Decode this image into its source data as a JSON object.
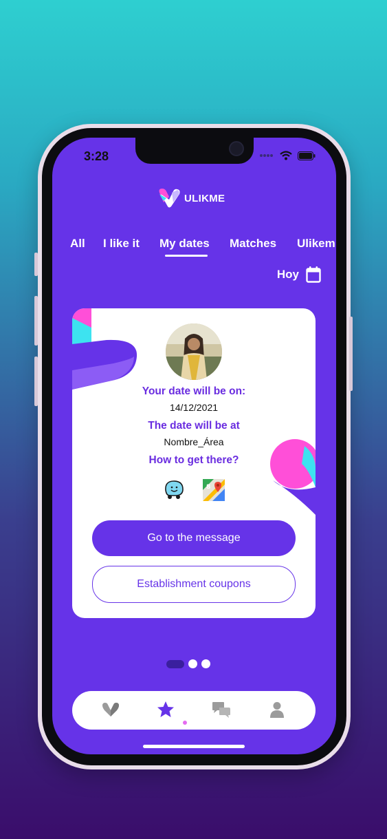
{
  "status_bar": {
    "time": "3:28"
  },
  "app": {
    "name": "ULIKME"
  },
  "tabs": [
    "All",
    "I like it",
    "My dates",
    "Matches",
    "Ulikem"
  ],
  "active_tab": "My dates",
  "date_filter": {
    "label": "Hoy"
  },
  "date_card": {
    "date_label": "Your date will be on:",
    "date_value": "14/12/2021",
    "place_label": "The date will be at",
    "place_value": "Nombre_Área",
    "directions_label": "How to get there?",
    "nav_apps": [
      "waze-icon",
      "google-maps-icon"
    ],
    "message_button": "Go to the message",
    "coupons_button": "Establishment coupons"
  },
  "pager": {
    "pages": 3,
    "current": 1
  },
  "bottom_nav": [
    "heart-icon",
    "star-icon",
    "chat-icon",
    "profile-icon"
  ],
  "colors": {
    "brand": "#6633e8",
    "accent_pink": "#ff4fd8",
    "accent_cyan": "#3de3f0"
  }
}
